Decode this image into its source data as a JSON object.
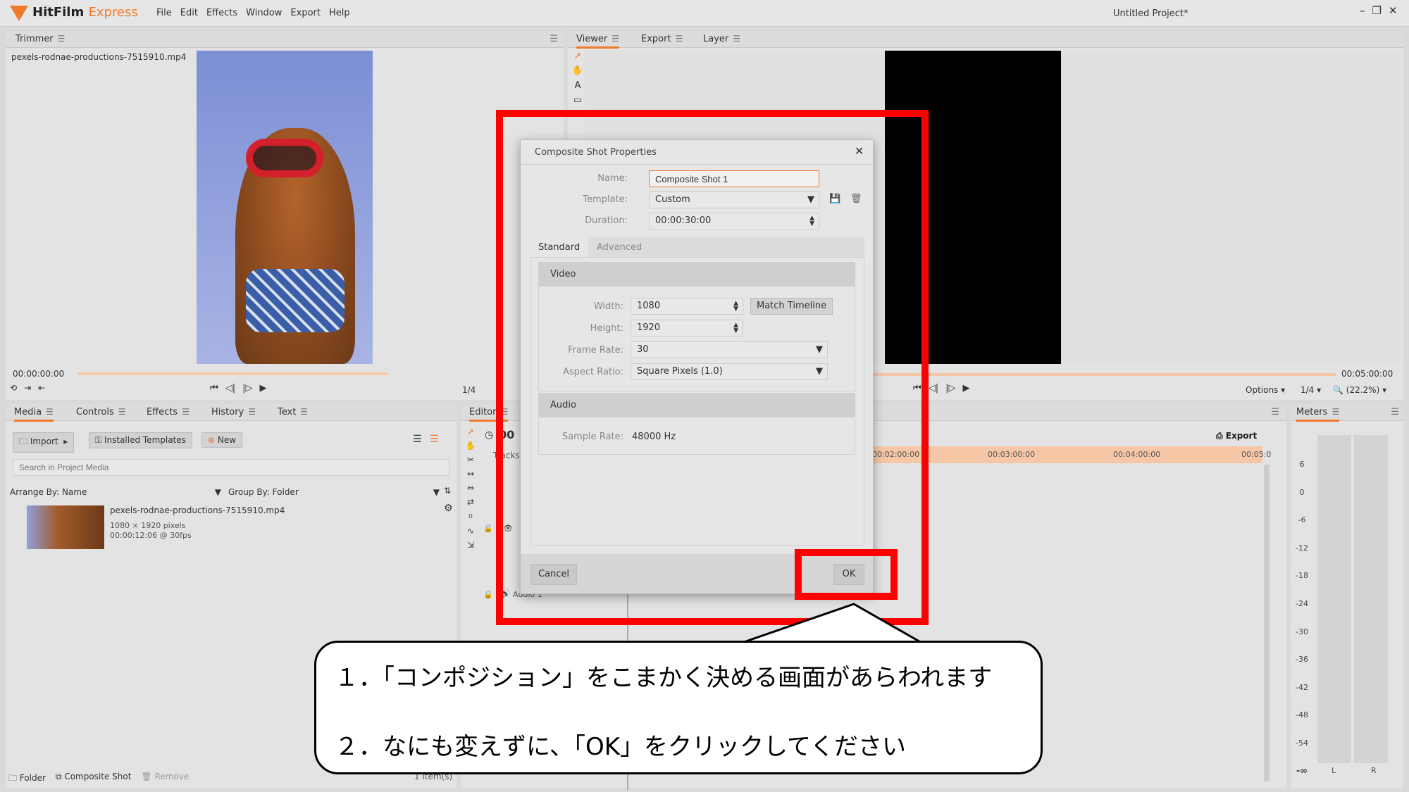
{
  "app": {
    "brand": "HitFilm",
    "brand2": "Express",
    "menu": [
      "File",
      "Edit",
      "Effects",
      "Window",
      "Export",
      "Help"
    ],
    "project": "Untitled Project*"
  },
  "trimmer": {
    "tab": "Trimmer",
    "file": "pexels-rodnae-productions-7515910.mp4",
    "time_start": "00:00:00:00",
    "zoom": "1/4"
  },
  "viewer": {
    "tabs": [
      "Viewer",
      "Export",
      "Layer"
    ],
    "time_end": "00:05:00:00",
    "time_partial": "00:0",
    "zoom_partial": "(22",
    "options": "Options",
    "zoom": "1/4",
    "percent": "(22.2%)"
  },
  "media": {
    "tabs": [
      "Media",
      "Controls",
      "Effects",
      "History",
      "Text"
    ],
    "import": "Import",
    "installed": "Installed Templates",
    "new": "New",
    "search_placeholder": "Search in Project Media",
    "arrange": "Arrange By: Name",
    "group": "Group By: Folder",
    "item": {
      "name": "pexels-rodnae-productions-7515910.mp4",
      "size": "1080 × 1920 pixels",
      "duration": "00:00:12:06 @ 30fps"
    },
    "footer": {
      "folder": "Folder",
      "composite": "Composite Shot",
      "remove": "Remove",
      "count": "1 item(s)"
    }
  },
  "editor": {
    "tab": "Editor",
    "time_partial": "00",
    "tracks": "Tracks",
    "audio_track": "Audio 1",
    "export": "Export",
    "ruler": [
      "00:02:00:00",
      "00:03:00:00",
      "00:04:00:00",
      "00:05:0"
    ]
  },
  "meters": {
    "tab": "Meters",
    "scale": [
      "6",
      "0",
      "-6",
      "-12",
      "-18",
      "-24",
      "-30",
      "-36",
      "-42",
      "-48",
      "-54",
      "-∞"
    ],
    "l": "L",
    "r": "R"
  },
  "dialog": {
    "title": "Composite Shot Properties",
    "name_label": "Name:",
    "name_value": "Composite Shot 1",
    "template_label": "Template:",
    "template_value": "Custom",
    "duration_label": "Duration:",
    "duration_value": "00:00:30:00",
    "tab_standard": "Standard",
    "tab_advanced": "Advanced",
    "video_header": "Video",
    "width_label": "Width:",
    "width_value": "1080",
    "match": "Match Timeline",
    "height_label": "Height:",
    "height_value": "1920",
    "framerate_label": "Frame Rate:",
    "framerate_value": "30",
    "aspect_label": "Aspect Ratio:",
    "aspect_value": "Square Pixels (1.0)",
    "audio_header": "Audio",
    "samplerate_label": "Sample Rate:",
    "samplerate_value": "48000 Hz",
    "cancel": "Cancel",
    "ok": "OK"
  },
  "callout": {
    "line1": "１．「コンポジション」をこまかく決める画面があらわれます",
    "line2": "２．なにも変えずに、「OK」をクリックしてください"
  },
  "colors": {
    "accent": "#f07a2a",
    "highlight": "#ff0000"
  }
}
